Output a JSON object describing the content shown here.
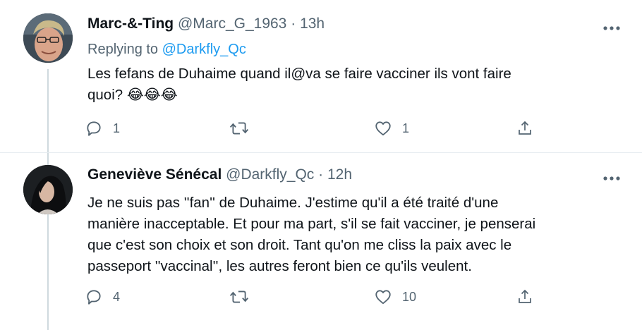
{
  "tweets": [
    {
      "name": "Marc-&-Ting",
      "handle": "@Marc_G_1963",
      "separator": "·",
      "time": "13h",
      "replying_label": "Replying to",
      "replying_to": "@Darkfly_Qc",
      "text": "Les fefans de Duhaime quand il@va se faire vacciner ils vont faire\nquoi? 😂😂😂",
      "reply_count": "1",
      "retweet_count": "",
      "like_count": "1"
    },
    {
      "name": "Geneviève Sénécal",
      "handle": "@Darkfly_Qc",
      "separator": "·",
      "time": "12h",
      "text": "Je ne suis pas ''fan'' de Duhaime. J'estime qu'il a été traité d'une\nmanière inacceptable. Et pour ma part, s'il se fait vacciner, je penserai\nque c'est son choix et son droit. Tant qu'on me cliss la paix avec le\npasseport ''vaccinal'', les autres feront bien ce qu'ils veulent.",
      "reply_count": "4",
      "retweet_count": "",
      "like_count": "10"
    }
  ],
  "icons": {
    "reply": "reply-icon",
    "retweet": "retweet-icon",
    "like": "heart-icon",
    "share": "share-icon",
    "more": "more-icon"
  },
  "colors": {
    "accent": "#1d9bf0",
    "secondary_text": "#536471",
    "primary_text": "#0f1419",
    "divider": "#e6ecf0"
  }
}
